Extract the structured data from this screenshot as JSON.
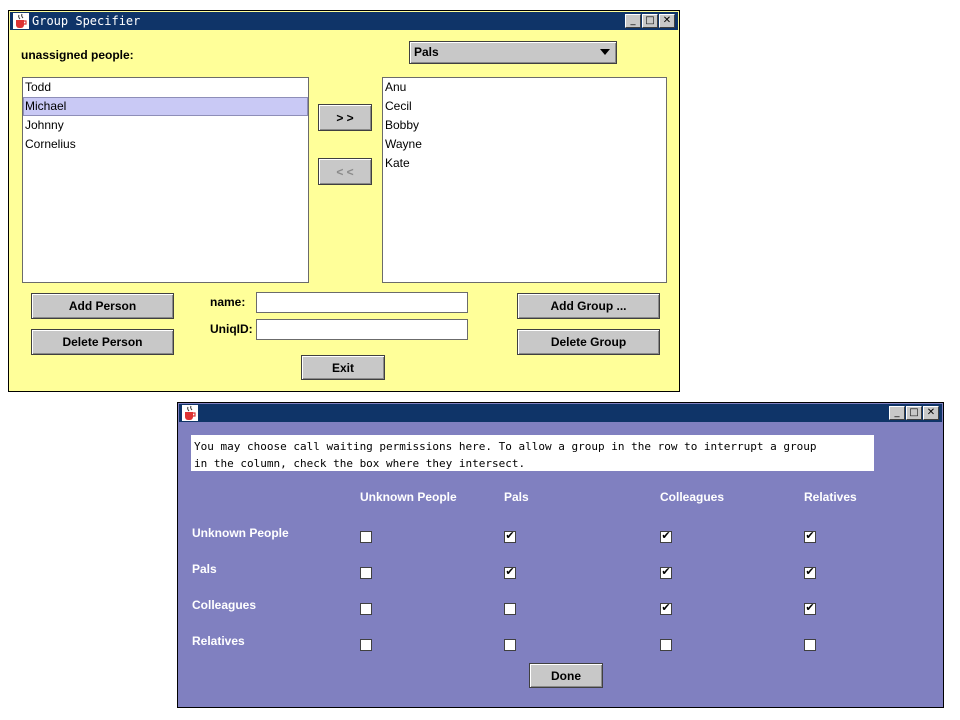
{
  "group_window": {
    "title": "Group Specifier",
    "unassigned_label": "unassigned people:",
    "group_select": "Pals",
    "unassigned_people": [
      "Todd",
      "Michael",
      "Johnny",
      "Cornelius"
    ],
    "selected_person": "Michael",
    "group_members": [
      "Anu",
      "Cecil",
      "Bobby",
      "Wayne",
      "Kate"
    ],
    "move_right_label": "> >",
    "move_left_label": "< <",
    "add_person_label": "Add Person",
    "delete_person_label": "Delete Person",
    "name_label": "name:",
    "name_value": "",
    "uniqid_label": "UniqID:",
    "uniqid_value": "",
    "add_group_label": "Add Group ...",
    "delete_group_label": "Delete Group",
    "exit_label": "Exit",
    "bg_color": "#ffff99"
  },
  "permissions_window": {
    "title": "",
    "note_line1": "You may choose call waiting permissions here.  To allow a group in the row to interrupt a group",
    "note_line2": "in the column, check the box where they intersect.",
    "columns": [
      "Unknown People",
      "Pals",
      "Colleagues",
      "Relatives"
    ],
    "rows": [
      {
        "label": "Unknown People",
        "checks": [
          false,
          true,
          true,
          true
        ]
      },
      {
        "label": "Pals",
        "checks": [
          false,
          true,
          true,
          true
        ]
      },
      {
        "label": "Colleagues",
        "checks": [
          false,
          false,
          true,
          true
        ]
      },
      {
        "label": "Relatives",
        "checks": [
          false,
          false,
          false,
          false
        ]
      }
    ],
    "done_label": "Done",
    "bg_color": "#8080c0"
  },
  "window_controls": {
    "minimize": "_",
    "maximize": "□",
    "close": "✕"
  }
}
